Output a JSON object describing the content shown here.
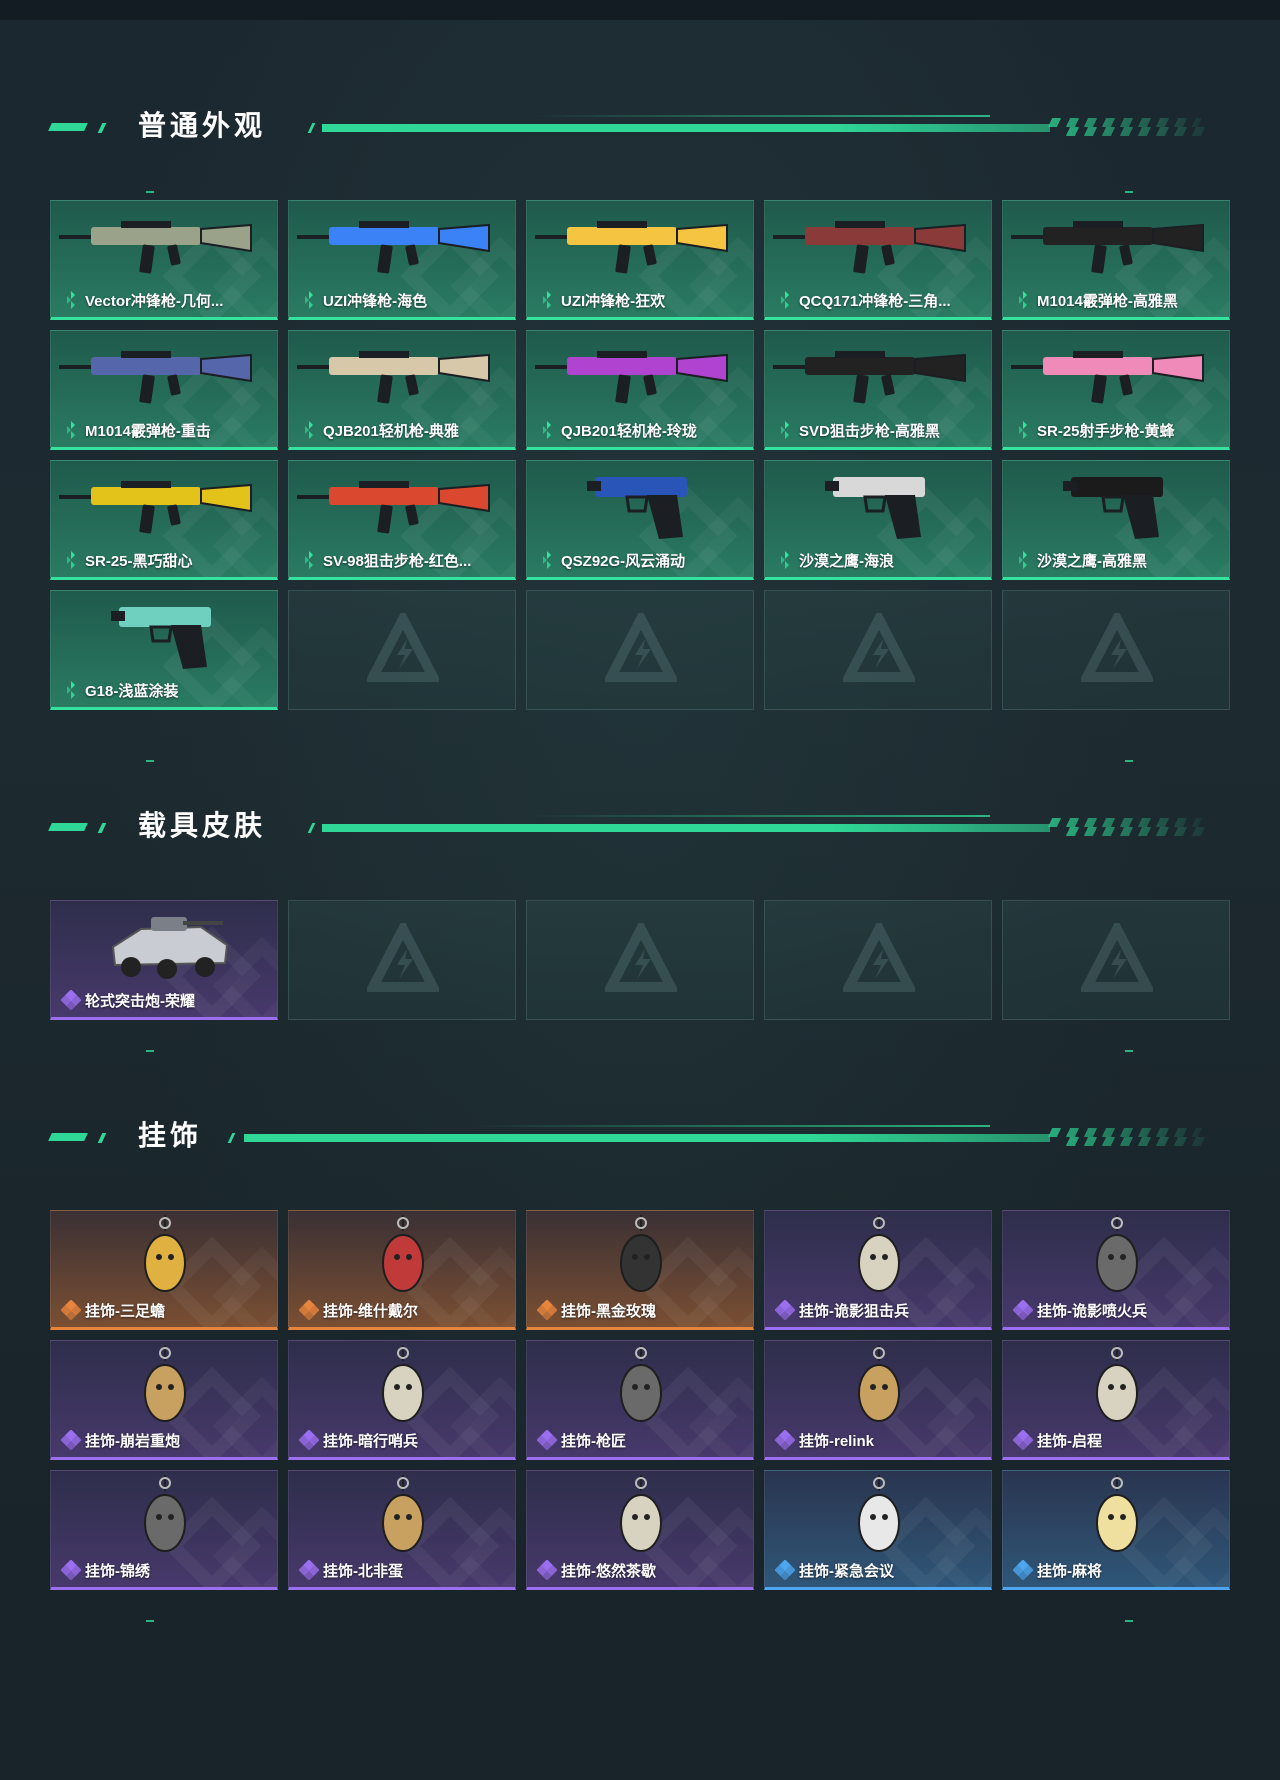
{
  "sections": [
    {
      "title": "普通外观",
      "items": [
        {
          "label": "Vector冲锋枪-几何...",
          "rarity": "green",
          "icon": "smg-icon"
        },
        {
          "label": "UZI冲锋枪-海色",
          "rarity": "green",
          "icon": "smg-icon"
        },
        {
          "label": "UZI冲锋枪-狂欢",
          "rarity": "green",
          "icon": "smg-icon"
        },
        {
          "label": "QCQ171冲锋枪-三角...",
          "rarity": "green",
          "icon": "smg-icon"
        },
        {
          "label": "M1014霰弹枪-高雅黑",
          "rarity": "green",
          "icon": "shotgun-icon"
        },
        {
          "label": "M1014霰弹枪-重击",
          "rarity": "green",
          "icon": "shotgun-icon"
        },
        {
          "label": "QJB201轻机枪-典雅",
          "rarity": "green",
          "icon": "lmg-icon"
        },
        {
          "label": "QJB201轻机枪-玲珑",
          "rarity": "green",
          "icon": "lmg-icon"
        },
        {
          "label": "SVD狙击步枪-高雅黑",
          "rarity": "green",
          "icon": "sniper-rifle-icon"
        },
        {
          "label": "SR-25射手步枪-黄蜂",
          "rarity": "green",
          "icon": "marksman-rifle-icon"
        },
        {
          "label": "SR-25-黑巧甜心",
          "rarity": "green",
          "icon": "marksman-rifle-icon"
        },
        {
          "label": "SV-98狙击步枪-红色...",
          "rarity": "green",
          "icon": "sniper-rifle-icon"
        },
        {
          "label": "QSZ92G-风云涌动",
          "rarity": "green",
          "icon": "pistol-icon"
        },
        {
          "label": "沙漠之鹰-海浪",
          "rarity": "green",
          "icon": "pistol-icon"
        },
        {
          "label": "沙漠之鹰-高雅黑",
          "rarity": "green",
          "icon": "pistol-icon"
        },
        {
          "label": "G18-浅蓝涂装",
          "rarity": "green",
          "icon": "pistol-icon"
        },
        {
          "empty": true
        },
        {
          "empty": true
        },
        {
          "empty": true
        },
        {
          "empty": true
        }
      ]
    },
    {
      "title": "载具皮肤",
      "items": [
        {
          "label": "轮式突击炮-荣耀",
          "rarity": "purple",
          "icon": "armored-vehicle-icon"
        },
        {
          "empty": true
        },
        {
          "empty": true
        },
        {
          "empty": true
        },
        {
          "empty": true
        }
      ]
    },
    {
      "title": "挂饰",
      "items": [
        {
          "label": "挂饰-三足蟾",
          "rarity": "orange",
          "icon": "charm-icon"
        },
        {
          "label": "挂饰-维什戴尔",
          "rarity": "orange",
          "icon": "charm-icon"
        },
        {
          "label": "挂饰-黑金玫瑰",
          "rarity": "orange",
          "icon": "charm-icon"
        },
        {
          "label": "挂饰-诡影狙击兵",
          "rarity": "purple",
          "icon": "charm-icon"
        },
        {
          "label": "挂饰-诡影喷火兵",
          "rarity": "purple",
          "icon": "charm-icon"
        },
        {
          "label": "挂饰-崩岩重炮",
          "rarity": "purple",
          "icon": "charm-icon"
        },
        {
          "label": "挂饰-暗行哨兵",
          "rarity": "purple",
          "icon": "charm-icon"
        },
        {
          "label": "挂饰-枪匠",
          "rarity": "purple",
          "icon": "charm-icon"
        },
        {
          "label": "挂饰-relink",
          "rarity": "purple",
          "icon": "charm-icon"
        },
        {
          "label": "挂饰-启程",
          "rarity": "purple",
          "icon": "charm-icon"
        },
        {
          "label": "挂饰-锦绣",
          "rarity": "purple",
          "icon": "charm-icon"
        },
        {
          "label": "挂饰-北非蛋",
          "rarity": "purple",
          "icon": "charm-icon"
        },
        {
          "label": "挂饰-悠然茶歇",
          "rarity": "purple",
          "icon": "charm-icon"
        },
        {
          "label": "挂饰-紧急会议",
          "rarity": "blue",
          "icon": "charm-icon"
        },
        {
          "label": "挂饰-麻将",
          "rarity": "blue",
          "icon": "charm-icon"
        }
      ]
    }
  ],
  "colors": {
    "accent": "#2fd897",
    "green": "#34e39e",
    "purple": "#9c6ef0",
    "orange": "#e8853c",
    "blue": "#4ea5f0"
  }
}
